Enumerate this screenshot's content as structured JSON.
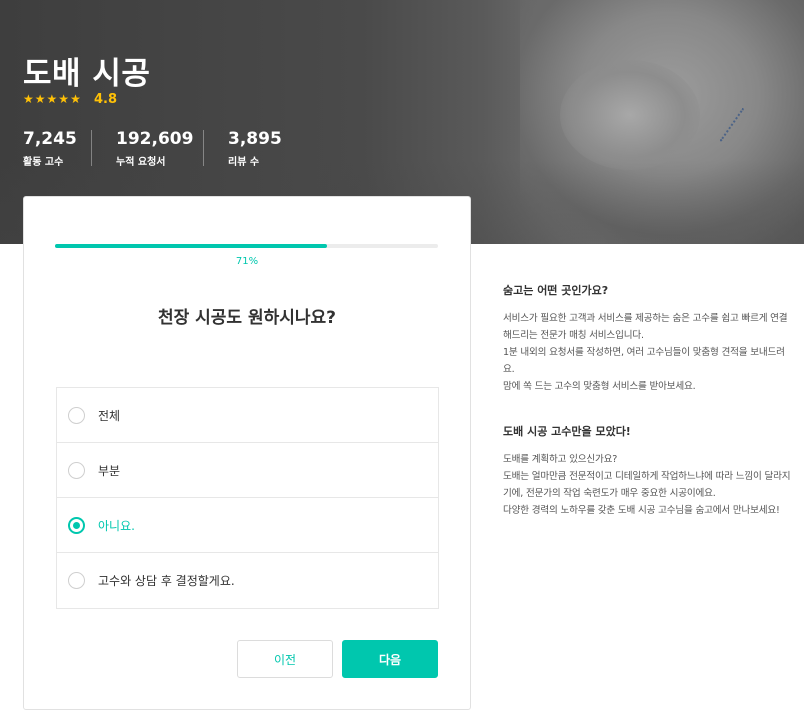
{
  "hero": {
    "title": "도배 시공",
    "rating": "4.8",
    "star_count": 5,
    "stats": [
      {
        "value": "7,245",
        "label": "활동 고수"
      },
      {
        "value": "192,609",
        "label": "누적 요청서"
      },
      {
        "value": "3,895",
        "label": "리뷰 수"
      }
    ]
  },
  "form": {
    "progress_percent": 71,
    "progress_label": "71%",
    "question": "천장 시공도 원하시나요?",
    "options": [
      {
        "label": "전체",
        "selected": false
      },
      {
        "label": "부분",
        "selected": false
      },
      {
        "label": "아니요.",
        "selected": true
      },
      {
        "label": "고수와 상담 후 결정할게요.",
        "selected": false
      }
    ],
    "prev_label": "이전",
    "next_label": "다음"
  },
  "info": {
    "section1": {
      "title": "숨고는 어떤 곳인가요?",
      "lines": [
        "서비스가 필요한 고객과 서비스를 제공하는 숨은 고수를 쉽고 빠르게 연결해드리는 전문가 매칭 서비스입니다.",
        "1분 내외의 요청서를 작성하면, 여러 고수님들이 맞춤형 견적을 보내드려요.",
        "맘에 쏙 드는 고수의 맞춤형 서비스를 받아보세요."
      ]
    },
    "section2": {
      "title": "도배 시공 고수만을 모았다!",
      "lines": [
        "도배를 계획하고 있으신가요?",
        "도배는 얼마만큼 전문적이고 디테일하게 작업하느냐에 따라 느낌이 달라지기에, 전문가의 작업 숙련도가 매우 중요한 시공이에요.",
        "다양한 경력의 노하우를 갖춘 도배 시공 고수님을 숨고에서 만나보세요!"
      ]
    }
  },
  "colors": {
    "accent": "#00c7ae",
    "star": "#ffc107"
  },
  "icons": {
    "star": "star-icon",
    "radio": "radio-icon"
  }
}
